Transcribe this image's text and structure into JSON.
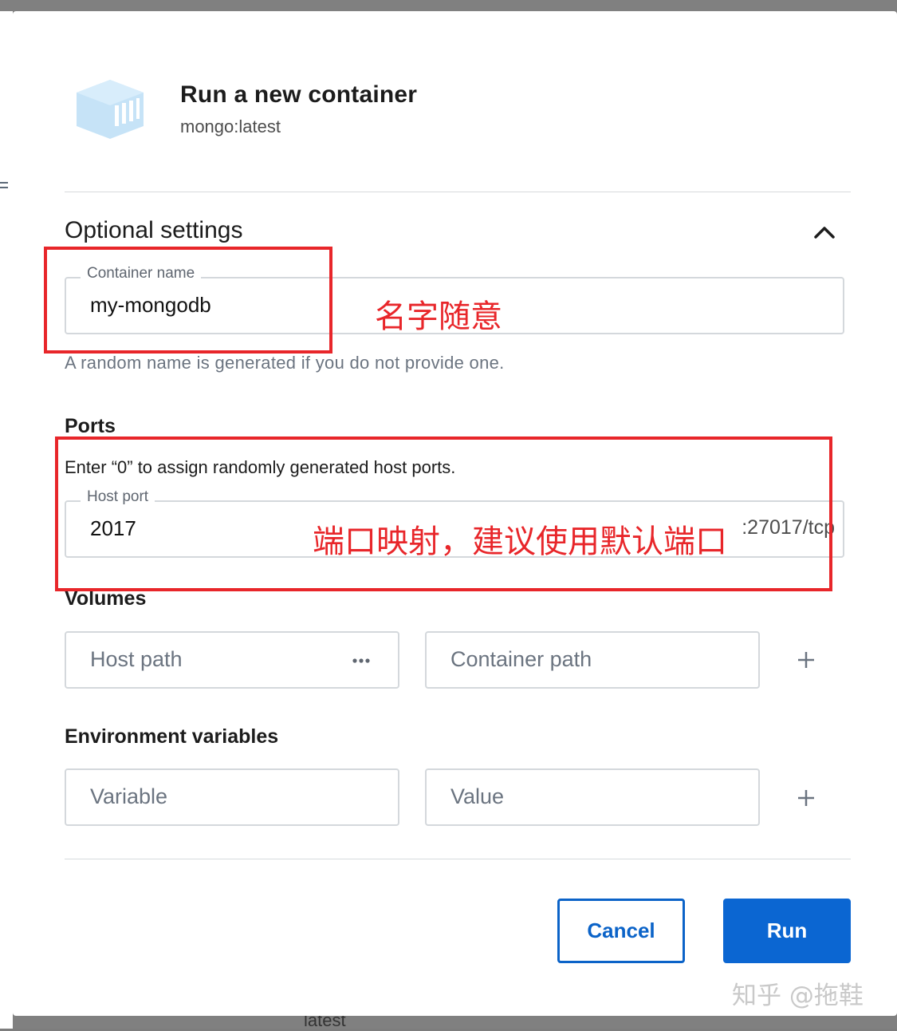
{
  "dialog": {
    "title": "Run a new container",
    "image": "mongo:latest"
  },
  "optional_settings": {
    "title": "Optional settings",
    "container_name": {
      "label": "Container name",
      "value": "my-mongodb",
      "helper": "A random name is generated if you do not provide one."
    },
    "ports": {
      "title": "Ports",
      "hint": "Enter “0” to assign randomly generated host ports.",
      "host_port_label": "Host port",
      "host_port_value": "2017",
      "container_port": ":27017/tcp"
    },
    "volumes": {
      "title": "Volumes",
      "host_path_placeholder": "Host path",
      "container_path_placeholder": "Container path"
    },
    "environment": {
      "title": "Environment variables",
      "variable_placeholder": "Variable",
      "value_placeholder": "Value"
    }
  },
  "actions": {
    "cancel_label": "Cancel",
    "run_label": "Run"
  },
  "background": {
    "partial_text": "latest"
  },
  "annotations": {
    "name_note": "名字随意",
    "port_note": "端口映射，建议使用默认端口"
  },
  "watermark": "知乎 @拖鞋",
  "colors": {
    "primary": "#0b66d2",
    "annotation": "#e8262a",
    "icon_light_blue": "#c6e3f7"
  },
  "icons": {
    "header": "container-box-icon",
    "collapse": "chevron-up-icon",
    "browse": "ellipsis-icon",
    "add": "plus-icon"
  }
}
